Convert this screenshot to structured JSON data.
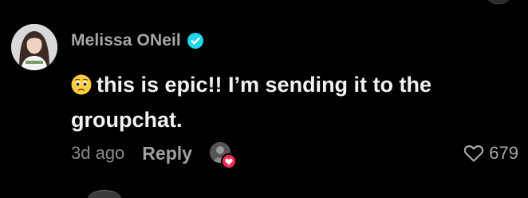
{
  "comment": {
    "username": "Melissa ONeil",
    "verified": true,
    "avatar_icon": "profile-photo",
    "emoji_icon": "pleading-face-emoji",
    "text": "this is epic!! I’m sending it to the groupchat.",
    "timestamp": "3d ago",
    "reply_label": "Reply",
    "creator_liked_icon": "creator-liked-heart",
    "like_icon": "heart-outline",
    "like_count": "679"
  },
  "colors": {
    "background": "#000000",
    "username": "#a8a8a8",
    "text": "#f2f2f2",
    "verified": "#20d5ec",
    "like_badge": "#fe2c55"
  }
}
